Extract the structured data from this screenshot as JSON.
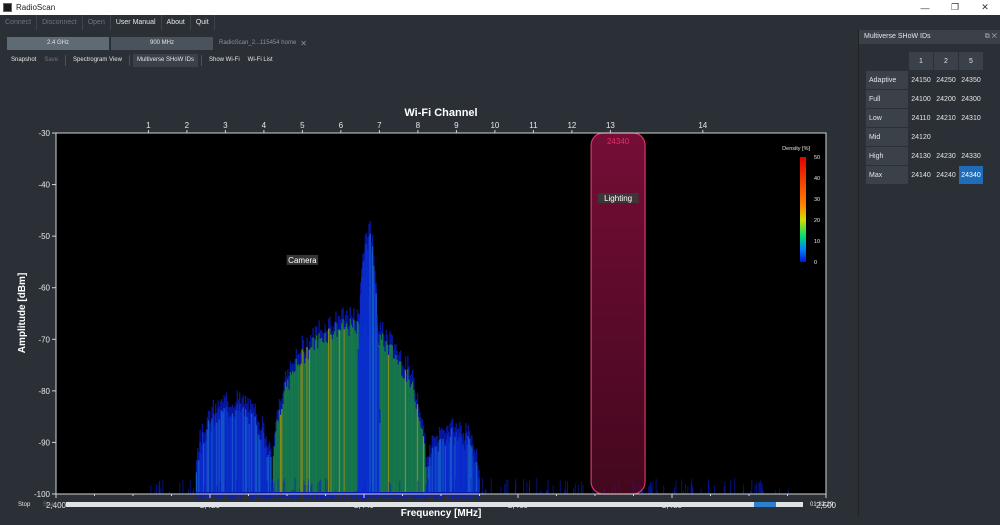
{
  "window": {
    "title": "RadioScan"
  },
  "window_controls": [
    "—",
    "❐",
    "✕"
  ],
  "menu": [
    {
      "label": "Connect",
      "enabled": false
    },
    {
      "label": "Disconnect",
      "enabled": false
    },
    {
      "label": "Open",
      "enabled": false
    },
    {
      "label": "User Manual",
      "enabled": true
    },
    {
      "label": "About",
      "enabled": true
    },
    {
      "label": "Quit",
      "enabled": true
    }
  ],
  "band_tabs": [
    {
      "label": "2.4 GHz",
      "active": true
    },
    {
      "label": "900 MHz",
      "active": false
    }
  ],
  "file_tab": {
    "label": "RadioScan_2...115454 home",
    "close": "✕"
  },
  "toolbar": [
    {
      "label": "Snapshot",
      "state": "normal"
    },
    {
      "label": "Save",
      "state": "disabled"
    },
    {
      "label": "Spectrogram View",
      "state": "normal"
    },
    {
      "label": "Multiverse SHoW IDs",
      "state": "selected"
    },
    {
      "label": "Show Wi-Fi",
      "state": "normal"
    },
    {
      "label": "Wi-Fi List",
      "state": "normal"
    }
  ],
  "chart_data": {
    "type": "heatmap",
    "title": "Wi-Fi Channel",
    "xlabel": "Frequency [MHz]",
    "ylabel": "Amplitude [dBm]",
    "xlim": [
      2400,
      2500
    ],
    "ylim": [
      -100,
      -30
    ],
    "x_ticks": [
      2400,
      2420,
      2440,
      2460,
      2480,
      2500
    ],
    "x_tick_labels": [
      "2,400",
      "2,420",
      "2,440",
      "2,460",
      "2,480",
      "2,500"
    ],
    "y_ticks": [
      -30,
      -40,
      -50,
      -60,
      -70,
      -80,
      -90,
      -100
    ],
    "y_tick_labels": [
      "-30",
      "-40",
      "-50",
      "-60",
      "-70",
      "-80",
      "-90",
      "-100"
    ],
    "channels": [
      {
        "label": "1",
        "freq": 2412
      },
      {
        "label": "2",
        "freq": 2417
      },
      {
        "label": "3",
        "freq": 2422
      },
      {
        "label": "4",
        "freq": 2427
      },
      {
        "label": "5",
        "freq": 2432
      },
      {
        "label": "6",
        "freq": 2437
      },
      {
        "label": "7",
        "freq": 2442
      },
      {
        "label": "8",
        "freq": 2447
      },
      {
        "label": "9",
        "freq": 2452
      },
      {
        "label": "10",
        "freq": 2457
      },
      {
        "label": "11",
        "freq": 2462
      },
      {
        "label": "12",
        "freq": 2467
      },
      {
        "label": "13",
        "freq": 2472
      },
      {
        "label": "14",
        "freq": 2484
      }
    ],
    "colorbar": {
      "label": "Density [%]",
      "ticks": [
        0,
        10,
        20,
        30,
        40,
        50
      ]
    },
    "signals": [
      {
        "name": "Camera",
        "f_start": 2428,
        "f_end": 2448,
        "peak_dbm": -67,
        "floor_dbm": -100,
        "density": 22
      },
      {
        "name": "Camera narrow",
        "f_start": 2439,
        "f_end": 2442,
        "peak_dbm": -50,
        "floor_dbm": -100,
        "density": 8
      },
      {
        "name": "Side left",
        "f_start": 2418,
        "f_end": 2428,
        "peak_dbm": -83,
        "floor_dbm": -100,
        "density": 6
      },
      {
        "name": "Side right",
        "f_start": 2448,
        "f_end": 2455,
        "peak_dbm": -88,
        "floor_dbm": -100,
        "density": 6
      }
    ],
    "annotations": [
      {
        "text": "Camera",
        "x": 2432,
        "y": -55
      },
      {
        "text": "Lighting",
        "x": 2473,
        "y": -43
      }
    ],
    "highlight_box": {
      "label": "24340",
      "f_start": 2469.5,
      "f_end": 2476.5,
      "dbm_top": -30,
      "dbm_bottom": -100,
      "color": "#e0306a"
    }
  },
  "bottom": {
    "stop_label": "Stop",
    "scan_label": "Scan",
    "time": "01:32:29",
    "progress_start": 0.933,
    "progress_end": 0.964
  },
  "right_panel": {
    "title": "Multiverse SHoW IDs",
    "header_icons": [
      "⧉",
      "✕"
    ],
    "columns": [
      "1",
      "2",
      "5"
    ],
    "rows": [
      {
        "label": "Adaptive",
        "values": [
          "24150",
          "24250",
          "24350"
        ]
      },
      {
        "label": "Full",
        "values": [
          "24100",
          "24200",
          "24300"
        ]
      },
      {
        "label": "Low",
        "values": [
          "24110",
          "24210",
          "24310"
        ]
      },
      {
        "label": "Mid",
        "values": [
          "24120",
          "",
          ""
        ]
      },
      {
        "label": "High",
        "values": [
          "24130",
          "24230",
          "24330"
        ]
      },
      {
        "label": "Max",
        "values": [
          "24140",
          "24240",
          "24340"
        ]
      }
    ],
    "selected": "24340",
    "accent": "#1f6db8"
  }
}
